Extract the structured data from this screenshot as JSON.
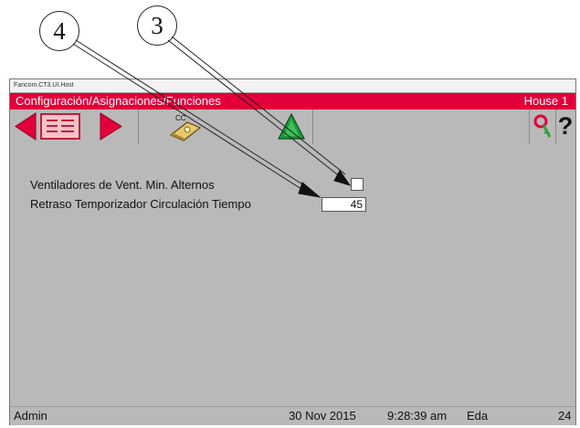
{
  "callouts": [
    "3",
    "4"
  ],
  "window": {
    "title": "Fancom.CT3.UI.Host",
    "breadcrumb": "Configuración/Asignaciones/Funciones",
    "house": "House 1"
  },
  "toolbar": {
    "icons": [
      "arrow-left-icon",
      "list-icon",
      "arrow-right-icon",
      "cc-tool-icon",
      "triangle-up-icon",
      "key-icon",
      "help-icon"
    ],
    "cc_label": "CC",
    "help_label": "?"
  },
  "settings": [
    {
      "label": "Ventiladores de Vent. Min. Alternos",
      "type": "checkbox",
      "checked": false
    },
    {
      "label": "Retraso Temporizador Circulación Tiempo",
      "type": "number",
      "value": "45"
    }
  ],
  "status": {
    "user": "Admin",
    "date": "30 Nov 2015",
    "time": "9:28:39 am",
    "eda_label": "Eda",
    "eda_value": "24"
  },
  "colors": {
    "accent": "#e3003a",
    "panel": "#b9b9b9",
    "arrow_red": "#e3003a",
    "triangle_green": "#1f9a3a"
  }
}
